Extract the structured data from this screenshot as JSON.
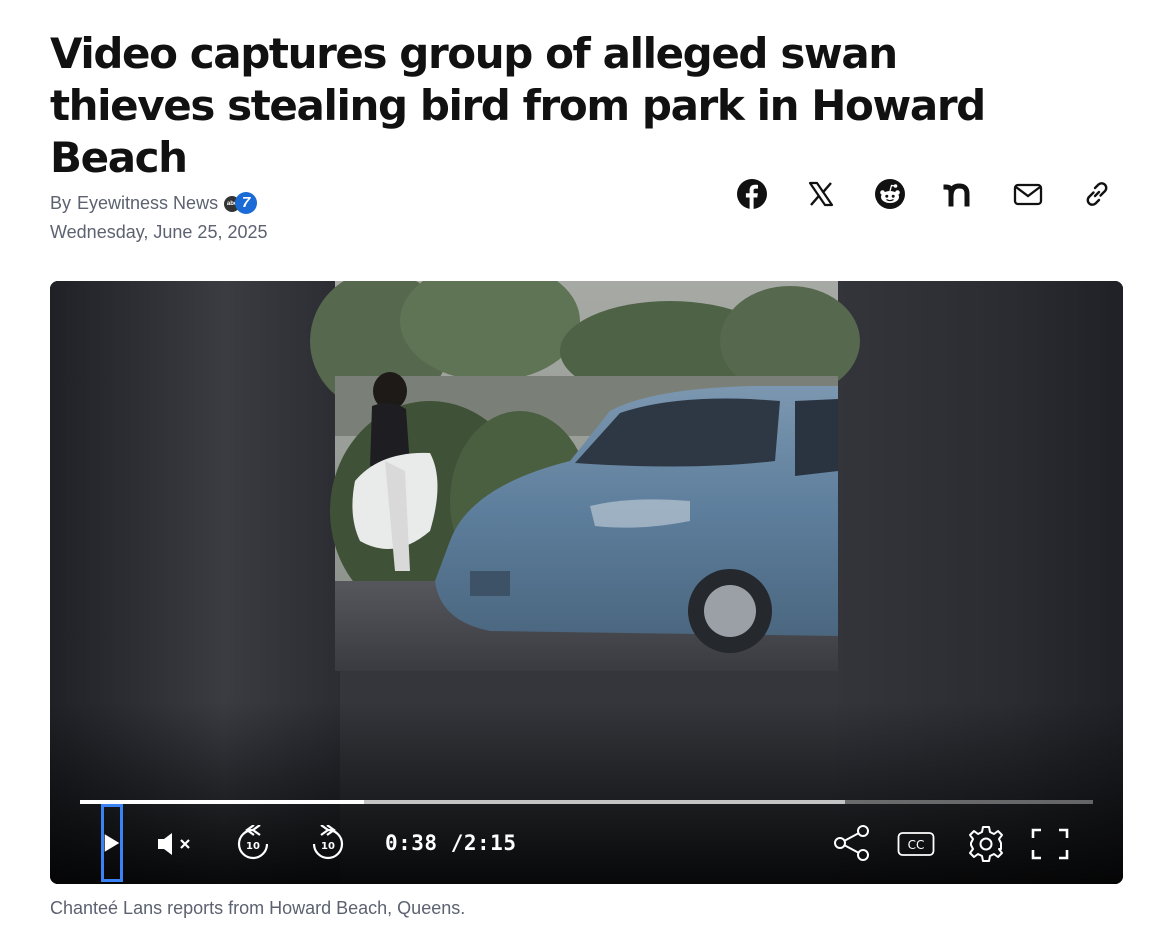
{
  "article": {
    "headline": "Video captures group of alleged swan thieves stealing bird from park in Howard Beach",
    "byline_prefix": "By",
    "author": "Eyewitness News",
    "station_logo_text": "7",
    "station_logo_small": "abc",
    "date": "Wednesday, June 25, 2025"
  },
  "share_icons": [
    "facebook-icon",
    "x-icon",
    "reddit-icon",
    "nextdoor-icon",
    "email-icon",
    "link-icon"
  ],
  "player": {
    "current_time": "0:38",
    "separator": "/",
    "duration": "2:15",
    "played_fraction": 0.28,
    "buffered_fraction": 0.755,
    "controls": [
      "play-icon",
      "mute-icon",
      "rewind-10-icon",
      "forward-10-icon",
      "share-icon",
      "closed-captions-icon",
      "settings-icon",
      "fullscreen-icon"
    ],
    "skip_seconds": "10",
    "cc_label": "CC",
    "focus_color": "#3b82f6"
  },
  "caption": "Chanteé Lans reports from Howard Beach, Queens."
}
